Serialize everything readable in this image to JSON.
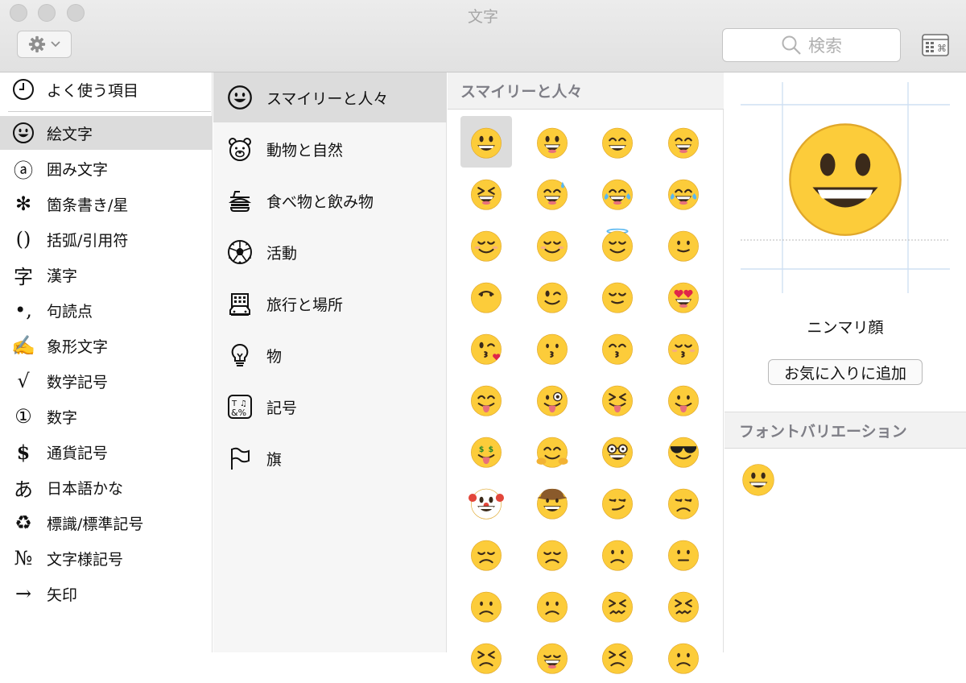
{
  "window": {
    "title": "文字"
  },
  "toolbar": {
    "gear_icon": "gear-icon",
    "search_placeholder": "検索",
    "search_icon": "search-icon",
    "grid_icon": "character-grid-icon"
  },
  "colors": {
    "selection": "#dcdcdc",
    "section_header_text": "#7e7e86",
    "emoji_face": "#fccc3a"
  },
  "categories": [
    {
      "label": "よく使う項目",
      "icon": "clock-icon"
    },
    {
      "label": "絵文字",
      "icon": "smiley-icon",
      "selected": true
    },
    {
      "label": "囲み文字",
      "icon": "circled-a-icon",
      "glyph": "ⓐ"
    },
    {
      "label": "箇条書き/星",
      "icon": "asterisk-icon",
      "glyph": "✻"
    },
    {
      "label": "括弧/引用符",
      "icon": "parentheses-icon",
      "glyph": "()"
    },
    {
      "label": "漢字",
      "icon": "kanji-icon",
      "glyph": "字"
    },
    {
      "label": "句読点",
      "icon": "punctuation-icon",
      "glyph": "•,"
    },
    {
      "label": "象形文字",
      "icon": "writing-hand-icon",
      "glyph": "✍"
    },
    {
      "label": "数学記号",
      "icon": "square-root-icon",
      "glyph": "√"
    },
    {
      "label": "数字",
      "icon": "circled-one-icon",
      "glyph": "①"
    },
    {
      "label": "通貨記号",
      "icon": "dollar-icon",
      "glyph": "$"
    },
    {
      "label": "日本語かな",
      "icon": "hiragana-a-icon",
      "glyph": "あ"
    },
    {
      "label": "標識/標準記号",
      "icon": "recycle-icon",
      "glyph": "♻"
    },
    {
      "label": "文字様記号",
      "icon": "numero-icon",
      "glyph": "№"
    },
    {
      "label": "矢印",
      "icon": "arrow-icon",
      "glyph": "→"
    }
  ],
  "subcategories": [
    {
      "label": "スマイリーと人々",
      "icon": "smiley-icon",
      "selected": true
    },
    {
      "label": "動物と自然",
      "icon": "bear-icon"
    },
    {
      "label": "食べ物と飲み物",
      "icon": "burger-icon"
    },
    {
      "label": "活動",
      "icon": "soccer-ball-icon"
    },
    {
      "label": "旅行と場所",
      "icon": "building-icon"
    },
    {
      "label": "物",
      "icon": "lightbulb-icon"
    },
    {
      "label": "記号",
      "icon": "symbols-icon"
    },
    {
      "label": "旗",
      "icon": "flag-icon"
    }
  ],
  "grid": {
    "section_title": "スマイリーと人々",
    "emoji": [
      "grinning",
      "grin-big",
      "grin-squint",
      "beaming",
      "laughing",
      "sweat-smile",
      "tears-of-joy",
      "rofl",
      "relaxed",
      "blush",
      "halo",
      "slight-smile",
      "upside-down",
      "wink",
      "relieved",
      "heart-eyes",
      "kissing-heart",
      "kissing",
      "kissing-smile",
      "kissing-closed",
      "yum",
      "crazy-tongue",
      "squint-tongue",
      "tongue",
      "money-mouth",
      "hugging",
      "nerd",
      "sunglasses",
      "clown",
      "cowboy",
      "smirk",
      "unamused",
      "disappointed",
      "pensive",
      "worried",
      "confused",
      "slight-frown",
      "frown",
      "persevere",
      "confounded",
      "tired",
      "weary",
      "triumph",
      "angry"
    ]
  },
  "detail": {
    "name": "ニンマリ顔",
    "favorite_button": "お気に入りに追加",
    "variations_title": "フォントバリエーション"
  }
}
